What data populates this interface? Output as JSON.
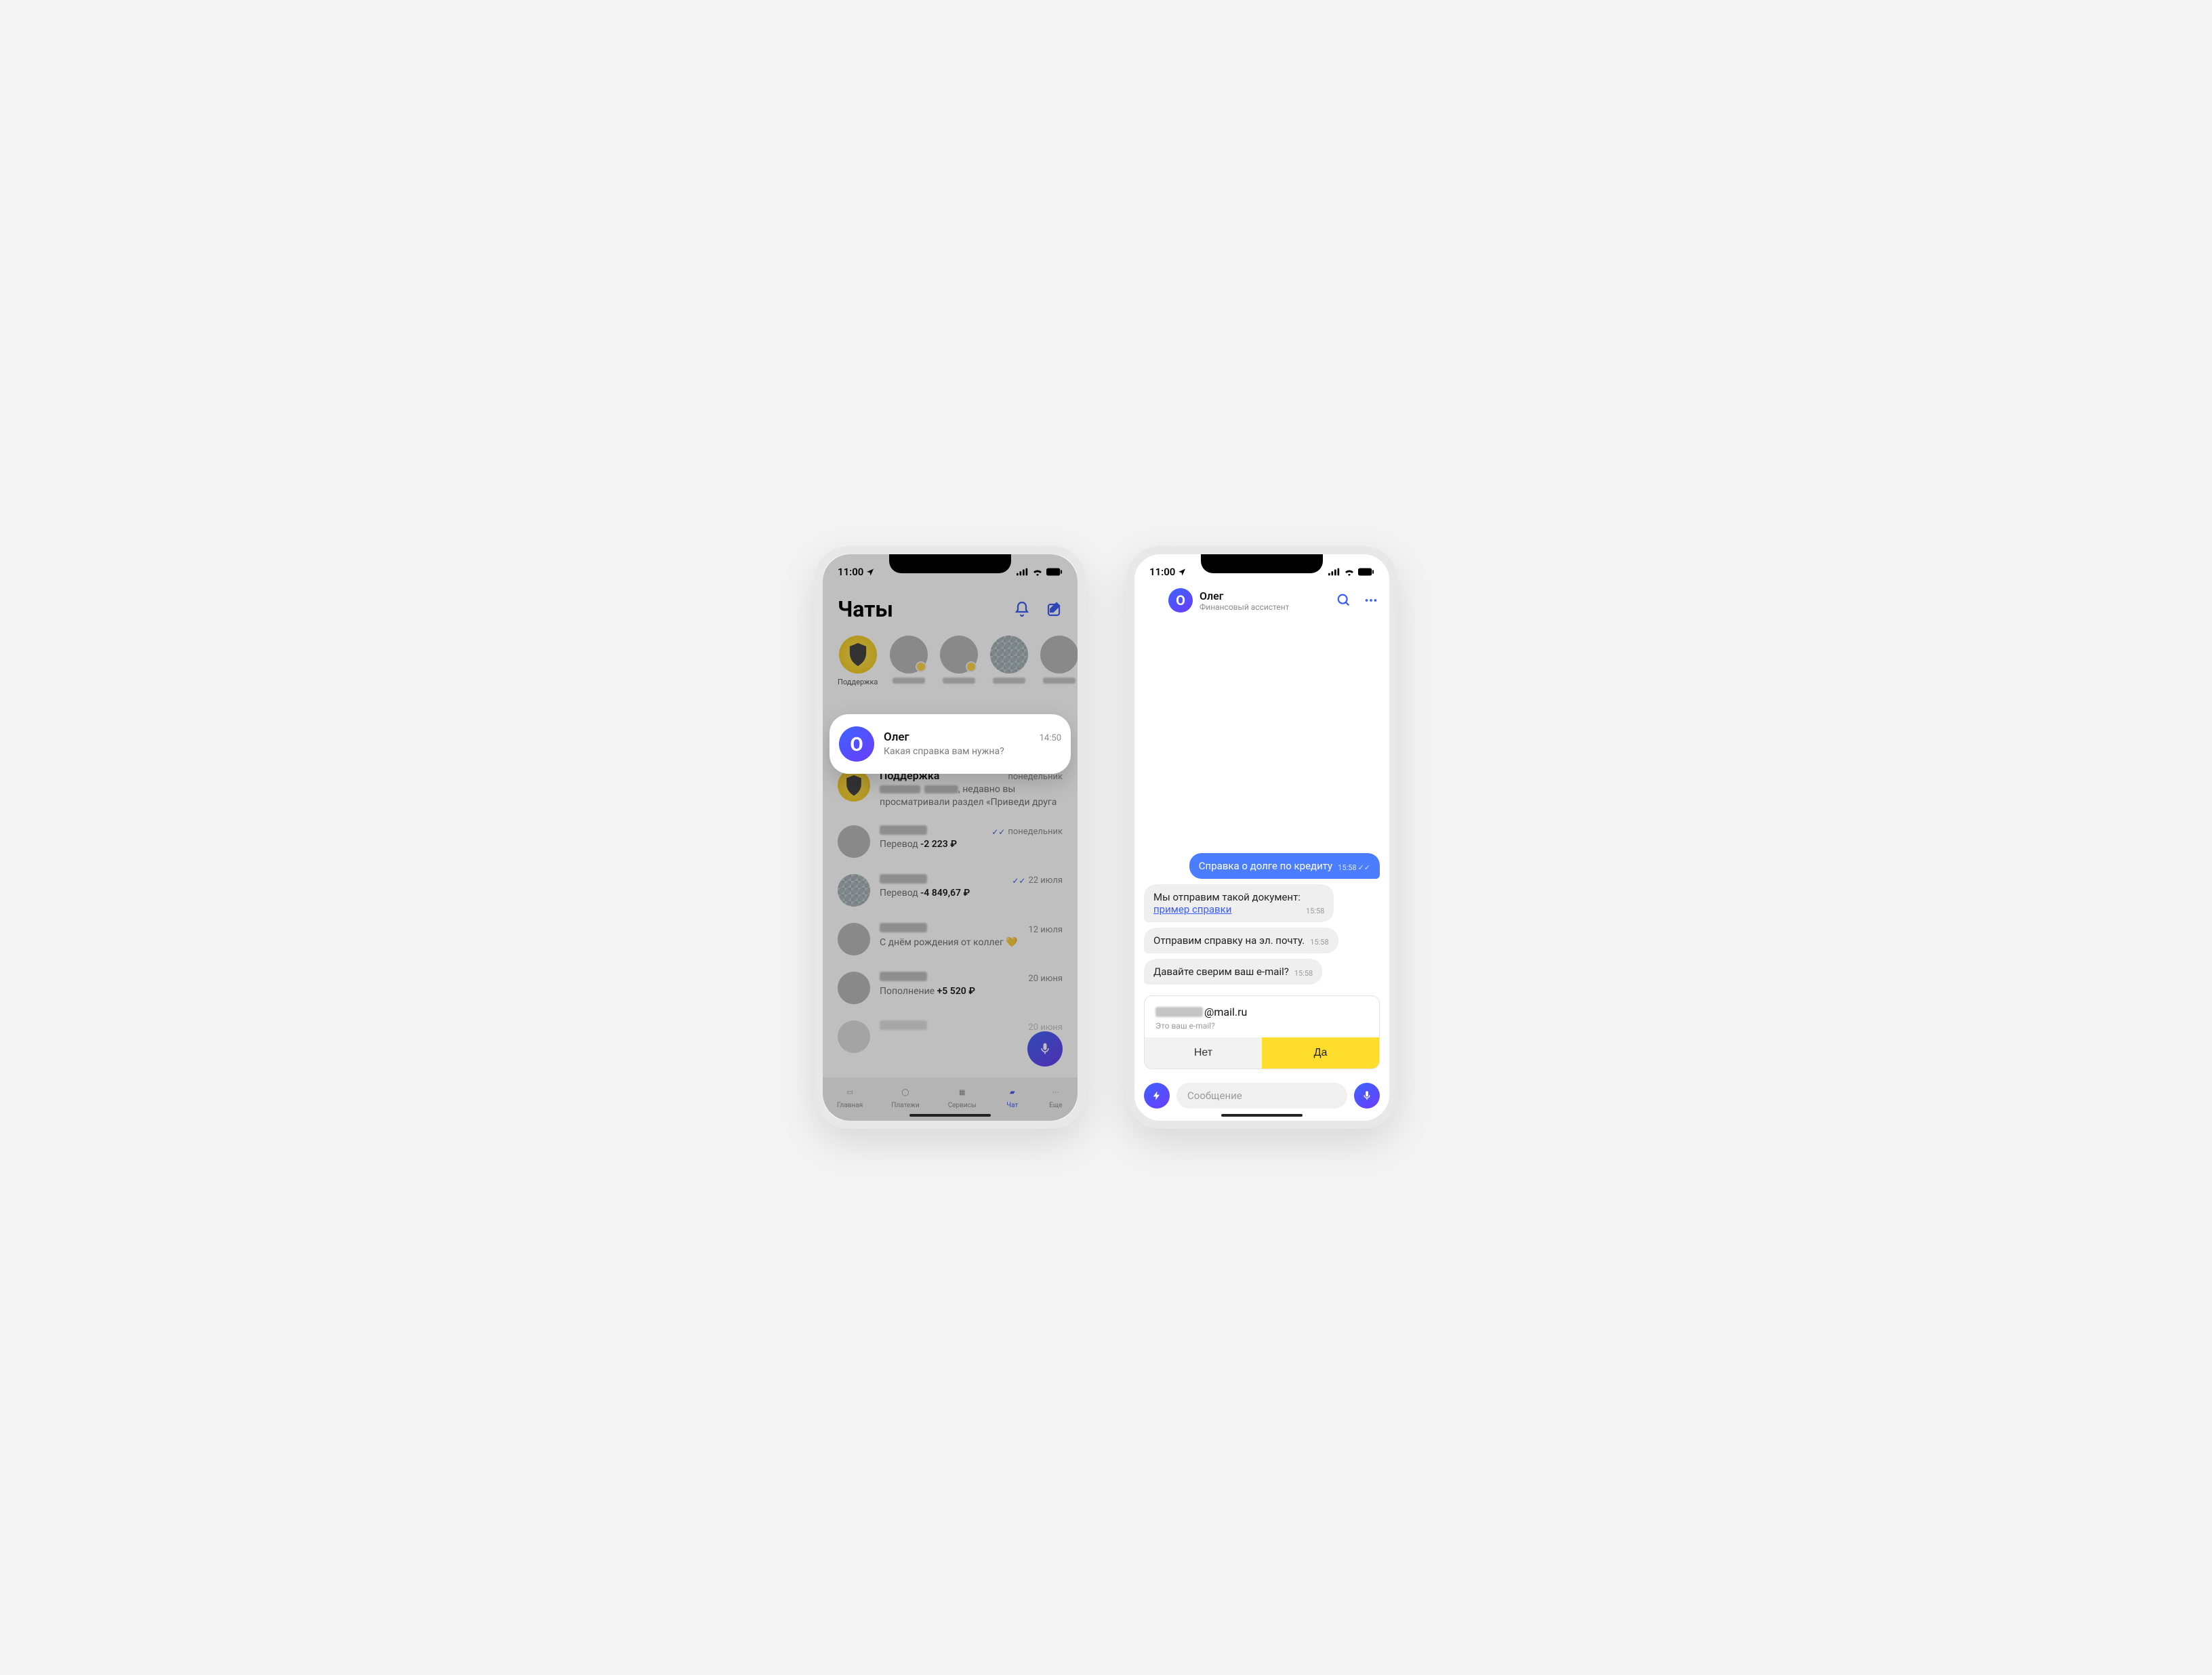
{
  "status": {
    "time": "11:00"
  },
  "left": {
    "title": "Чаты",
    "stories": {
      "support_label": "Поддержка"
    },
    "highlight": {
      "name": "Олег",
      "preview": "Какая справка вам нужна?",
      "time": "14:50"
    },
    "rows": {
      "support": {
        "name": "Поддержка",
        "time": "понедельник",
        "preview_suffix": ", недавно вы просматривали раздел «Приведи друга"
      },
      "transfer1": {
        "time": "понедельник",
        "label": "Перевод",
        "amount": "-2 223 ₽"
      },
      "transfer2": {
        "time": "22 июля",
        "label": "Перевод",
        "amount": "-4 849,67 ₽"
      },
      "birthday": {
        "time": "12 июля",
        "text": "С днём рождения от коллег 💛"
      },
      "topup": {
        "time": "20 июня",
        "label": "Пополнение",
        "amount": "+5 520 ₽"
      },
      "cutoff": {
        "time": "20 июня"
      }
    },
    "tabs": {
      "home": "Главная",
      "payments": "Платежи",
      "services": "Сервисы",
      "chat": "Чат",
      "more": "Еще"
    }
  },
  "right": {
    "header": {
      "name": "Олег",
      "subtitle": "Финансовый ассистент"
    },
    "messages": {
      "out1": {
        "text": "Справка о долге по кредиту",
        "time": "15:58"
      },
      "in1_prefix": "Мы отправим такой документ:",
      "in1_link": "пример справки",
      "in1_time": "15:58",
      "in2": {
        "text": "Отправим справку на эл. почту.",
        "time": "15:58"
      },
      "in3": {
        "text": "Давайте сверим ваш e-mail?",
        "time": "15:58"
      }
    },
    "email_card": {
      "domain": "@mail.ru",
      "sub": "Это ваш e-mail?",
      "no": "Нет",
      "yes": "Да"
    },
    "composer": {
      "placeholder": "Сообщение"
    }
  }
}
